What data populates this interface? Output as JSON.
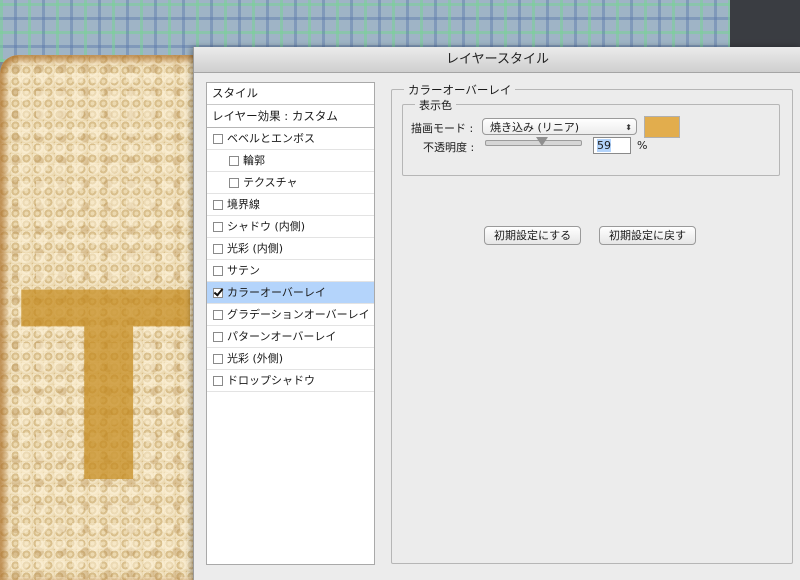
{
  "dialog": {
    "title": "レイヤースタイル"
  },
  "style_list": {
    "header": "スタイル",
    "effect_header": "レイヤー効果 : カスタム",
    "items": [
      {
        "label": "ベベルとエンボス",
        "checked": false,
        "indent": false,
        "selected": false
      },
      {
        "label": "輪郭",
        "checked": false,
        "indent": true,
        "selected": false
      },
      {
        "label": "テクスチャ",
        "checked": false,
        "indent": true,
        "selected": false
      },
      {
        "label": "境界線",
        "checked": false,
        "indent": false,
        "selected": false
      },
      {
        "label": "シャドウ (内側)",
        "checked": false,
        "indent": false,
        "selected": false
      },
      {
        "label": "光彩 (内側)",
        "checked": false,
        "indent": false,
        "selected": false
      },
      {
        "label": "サテン",
        "checked": false,
        "indent": false,
        "selected": false
      },
      {
        "label": "カラーオーバーレイ",
        "checked": true,
        "indent": false,
        "selected": true
      },
      {
        "label": "グラデーションオーバーレイ",
        "checked": false,
        "indent": false,
        "selected": false
      },
      {
        "label": "パターンオーバーレイ",
        "checked": false,
        "indent": false,
        "selected": false
      },
      {
        "label": "光彩 (外側)",
        "checked": false,
        "indent": false,
        "selected": false
      },
      {
        "label": "ドロップシャドウ",
        "checked": false,
        "indent": false,
        "selected": false
      }
    ]
  },
  "color_overlay": {
    "panel_title": "カラーオーバーレイ",
    "group_title": "表示色",
    "blend_mode_label": "描画モード :",
    "blend_mode_value": "焼き込み (リニア)",
    "overlay_color": "#e2ad4d",
    "opacity_label": "不透明度 :",
    "opacity_value": "59",
    "opacity_unit": "%",
    "opacity_fraction": 0.59,
    "make_default_label": "初期設定にする",
    "reset_default_label": "初期設定に戻す"
  },
  "canvas": {
    "letter": "T"
  }
}
